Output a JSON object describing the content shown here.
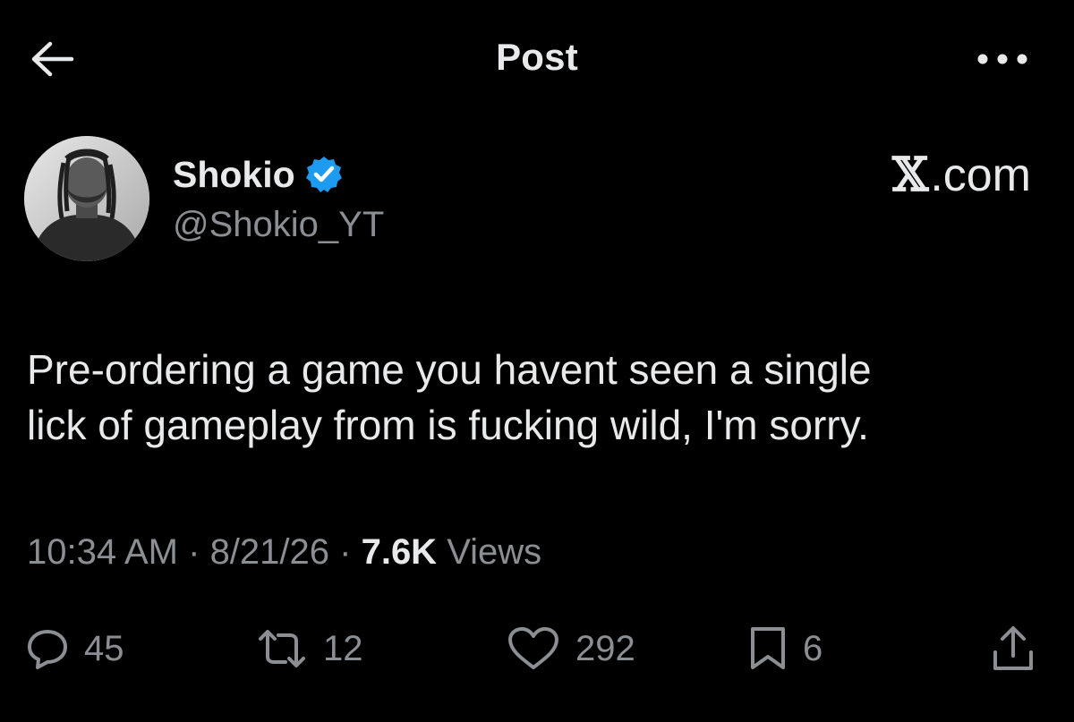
{
  "header": {
    "title": "Post",
    "back_icon": "arrow-left-icon",
    "more_icon": "more-horizontal-icon"
  },
  "author": {
    "name": "Shokio",
    "handle": "@Shokio_YT",
    "verified": true,
    "verified_color": "#1d9bf0"
  },
  "watermark": {
    "logo": "𝕏",
    "suffix": ".com"
  },
  "post": {
    "lines": [
      "Pre-ordering a game you havent seen a single",
      "lick of gameplay from is fucking wild, I'm sorry."
    ]
  },
  "meta": {
    "time": "10:34 AM",
    "sep1": " · ",
    "date": "8/21/26",
    "sep2": " · ",
    "views_count": "7.6K",
    "views_label": " Views"
  },
  "actions": {
    "replies": "45",
    "reposts": "12",
    "likes": "292",
    "bookmarks": "6"
  },
  "colors": {
    "background": "#000000",
    "text": "#e7e9ea",
    "secondary": "#8b8f94",
    "accent": "#1d9bf0"
  }
}
